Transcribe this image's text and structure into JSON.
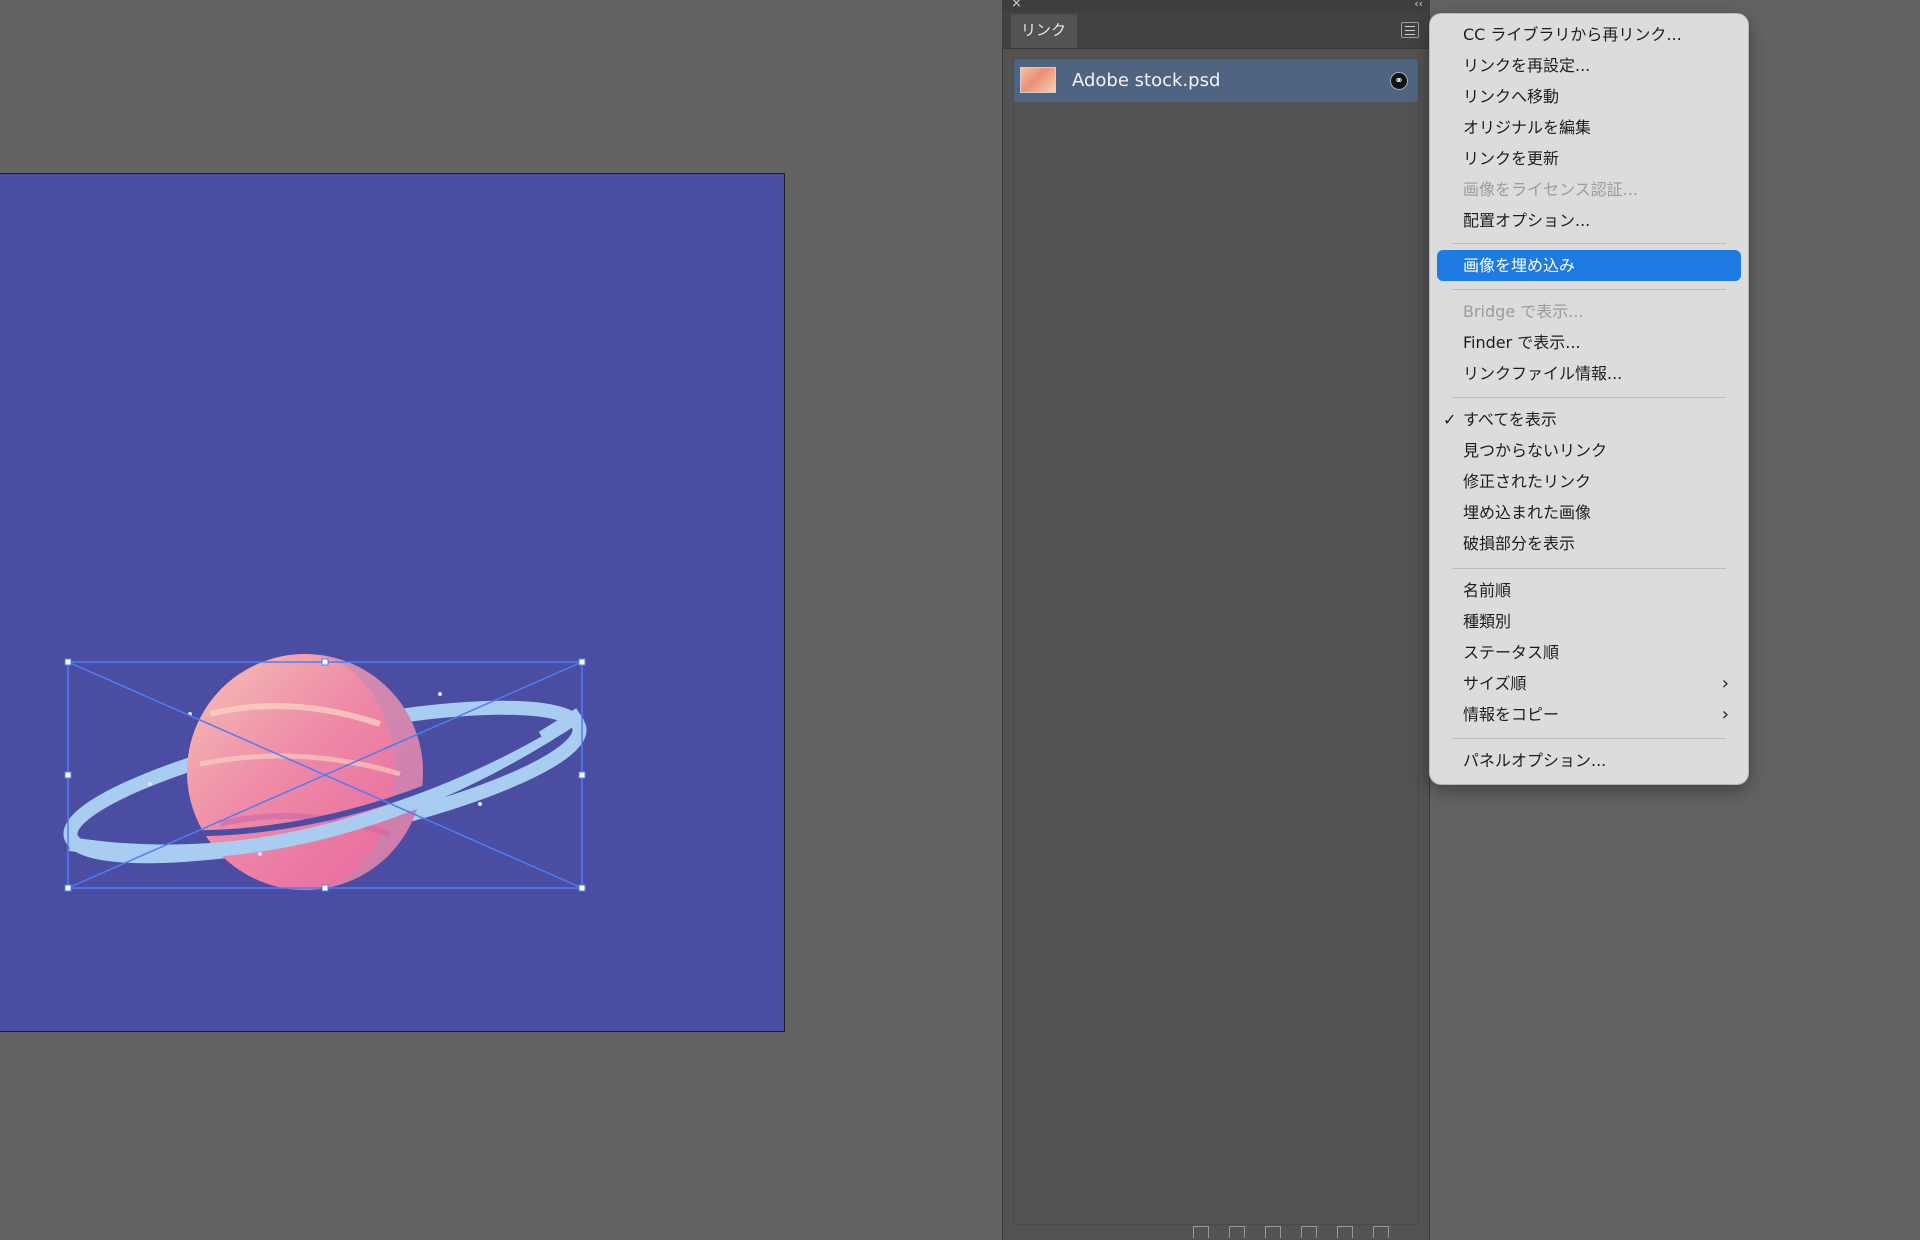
{
  "links_panel": {
    "close_glyph": "×",
    "collapse_glyph": "‹‹",
    "tab_label": "リンク",
    "links": [
      {
        "name": "Adobe stock.psd",
        "thumb_icon": "image-thumbnail-icon",
        "status_icon": "link-icon"
      }
    ],
    "footer_icons": [
      "relink-from-cc-icon",
      "relink-icon",
      "goto-link-icon",
      "update-link-icon",
      "edit-original-icon",
      "delete-icon"
    ]
  },
  "context_menu": {
    "items": [
      {
        "label": "CC ライブラリから再リンク...",
        "state": "enabled"
      },
      {
        "label": "リンクを再設定...",
        "state": "enabled"
      },
      {
        "label": "リンクへ移動",
        "state": "enabled"
      },
      {
        "label": "オリジナルを編集",
        "state": "enabled"
      },
      {
        "label": "リンクを更新",
        "state": "enabled"
      },
      {
        "label": "画像をライセンス認証...",
        "state": "disabled"
      },
      {
        "label": "配置オプション...",
        "state": "enabled"
      },
      {
        "label": "画像を埋め込み",
        "state": "selected"
      },
      {
        "label": "Bridge で表示...",
        "state": "disabled"
      },
      {
        "label": "Finder で表示...",
        "state": "enabled"
      },
      {
        "label": "リンクファイル情報...",
        "state": "enabled"
      },
      {
        "label": "すべてを表示",
        "state": "checked"
      },
      {
        "label": "見つからないリンク",
        "state": "enabled"
      },
      {
        "label": "修正されたリンク",
        "state": "enabled"
      },
      {
        "label": "埋め込まれた画像",
        "state": "enabled"
      },
      {
        "label": "破損部分を表示",
        "state": "enabled"
      },
      {
        "label": "名前順",
        "state": "enabled"
      },
      {
        "label": "種類別",
        "state": "enabled"
      },
      {
        "label": "ステータス順",
        "state": "enabled"
      },
      {
        "label": "サイズ順",
        "state": "submenu"
      },
      {
        "label": "情報をコピー",
        "state": "submenu"
      },
      {
        "label": "パネルオプション...",
        "state": "enabled"
      }
    ],
    "check_glyph": "✓",
    "submenu_glyph": "›",
    "selected_color": "#1f7be4"
  },
  "artboard": {
    "background_color": "#4a4da1",
    "artwork_icon": "planet-illustration"
  }
}
